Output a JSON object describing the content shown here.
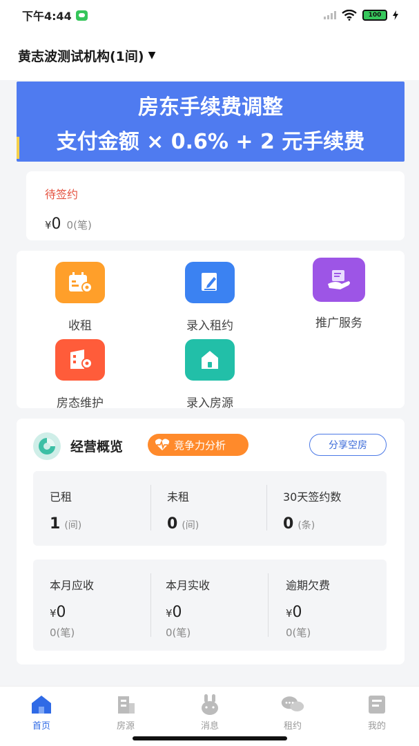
{
  "status_bar": {
    "time": "下午4:44",
    "battery": "100"
  },
  "header": {
    "title": "黄志波测试机构(1间)"
  },
  "banner": {
    "line1": "房东手续费调整",
    "line2": "支付金额 × 0.6% + 2 元手续费"
  },
  "pending": {
    "title": "待签约",
    "currency": "¥",
    "amount": "0",
    "count": "0(笔)"
  },
  "actions": [
    {
      "label": "收租",
      "icon": "calendar-icon",
      "color": "#ff9f2a"
    },
    {
      "label": "录入租约",
      "icon": "contract-edit-icon",
      "color": "#3b82f2"
    },
    {
      "label": "推广服务",
      "icon": "promotion-hand-icon",
      "color": "#9d55e6"
    },
    {
      "label": "房态维护",
      "icon": "building-gear-icon",
      "color": "#ff5c3a"
    },
    {
      "label": "录入房源",
      "icon": "house-add-icon",
      "color": "#22bfa8"
    }
  ],
  "overview": {
    "title": "经营概览",
    "compete_label": "竞争力分析",
    "share_label": "分享空房",
    "top_stats": [
      {
        "label": "已租",
        "value": "1",
        "unit": "(间)"
      },
      {
        "label": "未租",
        "value": "0",
        "unit": "(间)"
      },
      {
        "label": "30天签约数",
        "value": "0",
        "unit": "(条)"
      }
    ],
    "bottom_stats": [
      {
        "label": "本月应收",
        "currency": "¥",
        "value": "0",
        "count": "0(笔)"
      },
      {
        "label": "本月实收",
        "currency": "¥",
        "value": "0",
        "count": "0(笔)"
      },
      {
        "label": "逾期欠费",
        "currency": "¥",
        "value": "0",
        "count": "0(笔)"
      }
    ]
  },
  "tabbar": [
    {
      "label": "首页",
      "icon": "home-icon",
      "active": true
    },
    {
      "label": "房源",
      "icon": "building-icon",
      "active": false
    },
    {
      "label": "消息",
      "icon": "bunny-message-icon",
      "active": false
    },
    {
      "label": "租约",
      "icon": "chat-bubbles-icon",
      "active": false
    },
    {
      "label": "我的",
      "icon": "profile-card-icon",
      "active": false
    }
  ],
  "colors": {
    "accent": "#2f6ae6",
    "banner_bg": "#4f7bf0",
    "pending_title": "#e4513f",
    "compete_bg": "#ff8a2b"
  }
}
